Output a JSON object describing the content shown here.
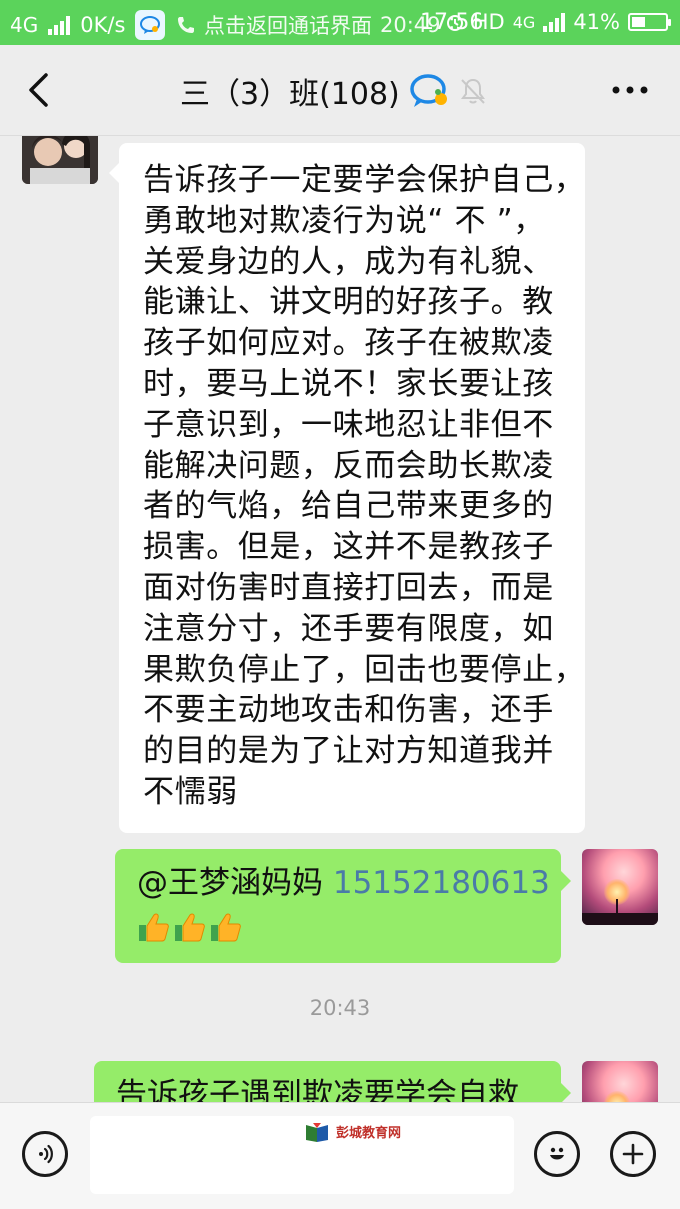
{
  "status_bar": {
    "network": "4G",
    "speed": "0K/s",
    "notification_text": "点击返回通话界面",
    "call_time": "20:49",
    "time": "17:56",
    "hd": "HD",
    "network_right": "4G",
    "battery": "41%",
    "battery_level": 0.41,
    "color": "#5bd35b"
  },
  "header": {
    "title": "三（3）班(108)"
  },
  "messages": [
    {
      "side": "left",
      "avatar": "avatar-girl",
      "lines": [
        "告诉孩子一定要学会保护自己，",
        "勇敢地对欺凌行为说“ 不 ”，",
        "关爱身边的人，成为有礼貌、",
        "能谦让、讲文明的好孩子。教",
        "孩子如何应对。孩子在被欺凌",
        "时，要马上说不！家长要让孩",
        "子意识到，一味地忍让非但不",
        "能解决问题，反而会助长欺凌",
        "者的气焰，给自己带来更多的",
        "损害。但是，这并不是教孩子",
        "面对伤害时直接打回去，而是",
        "注意分寸，还手要有限度，如",
        "果欺负停止了，回击也要停止，",
        "不要主动地攻击和伤害，还手",
        "的目的是为了让对方知道我并",
        "不懦弱"
      ]
    },
    {
      "side": "right",
      "mention": "@王梦涵妈妈",
      "phone": "15152180613",
      "emoji": [
        "thumbs-up",
        "thumbs-up",
        "thumbs-up"
      ]
    }
  ],
  "timestamp": "20:43",
  "last_message": {
    "side": "right",
    "text": "告诉孩子遇到欺凌要学会自救"
  },
  "watermark": {
    "text": "彭城教育网"
  },
  "colors": {
    "chat_bg": "#ededed",
    "bubble_white": "#ffffff",
    "bubble_green": "#95ec69",
    "phone_link": "#4a7ba8"
  }
}
